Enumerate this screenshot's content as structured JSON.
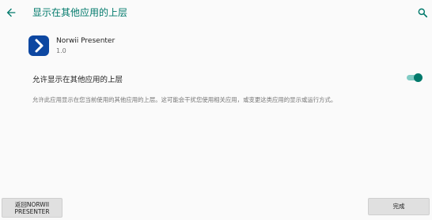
{
  "header": {
    "title": "显示在其他应用的上层",
    "back_icon": "arrow-back-icon",
    "search_icon": "search-icon"
  },
  "app": {
    "name": "Norwii Presenter",
    "version": "1.0",
    "icon": "chevron-right-app-icon"
  },
  "permission": {
    "label": "允许显示在其他应用的上层",
    "enabled": true,
    "description": "允许此应用显示在您当前使用的其他应用的上层。这可能会干扰您使用相关应用，或变更这类应用的显示或运行方式。"
  },
  "footer": {
    "back_label_line1": "返回NORWII",
    "back_label_line2": "PRESENTER",
    "done_label": "完成"
  },
  "colors": {
    "accent": "#00796b",
    "app_icon_bg": "#0d47a1"
  }
}
